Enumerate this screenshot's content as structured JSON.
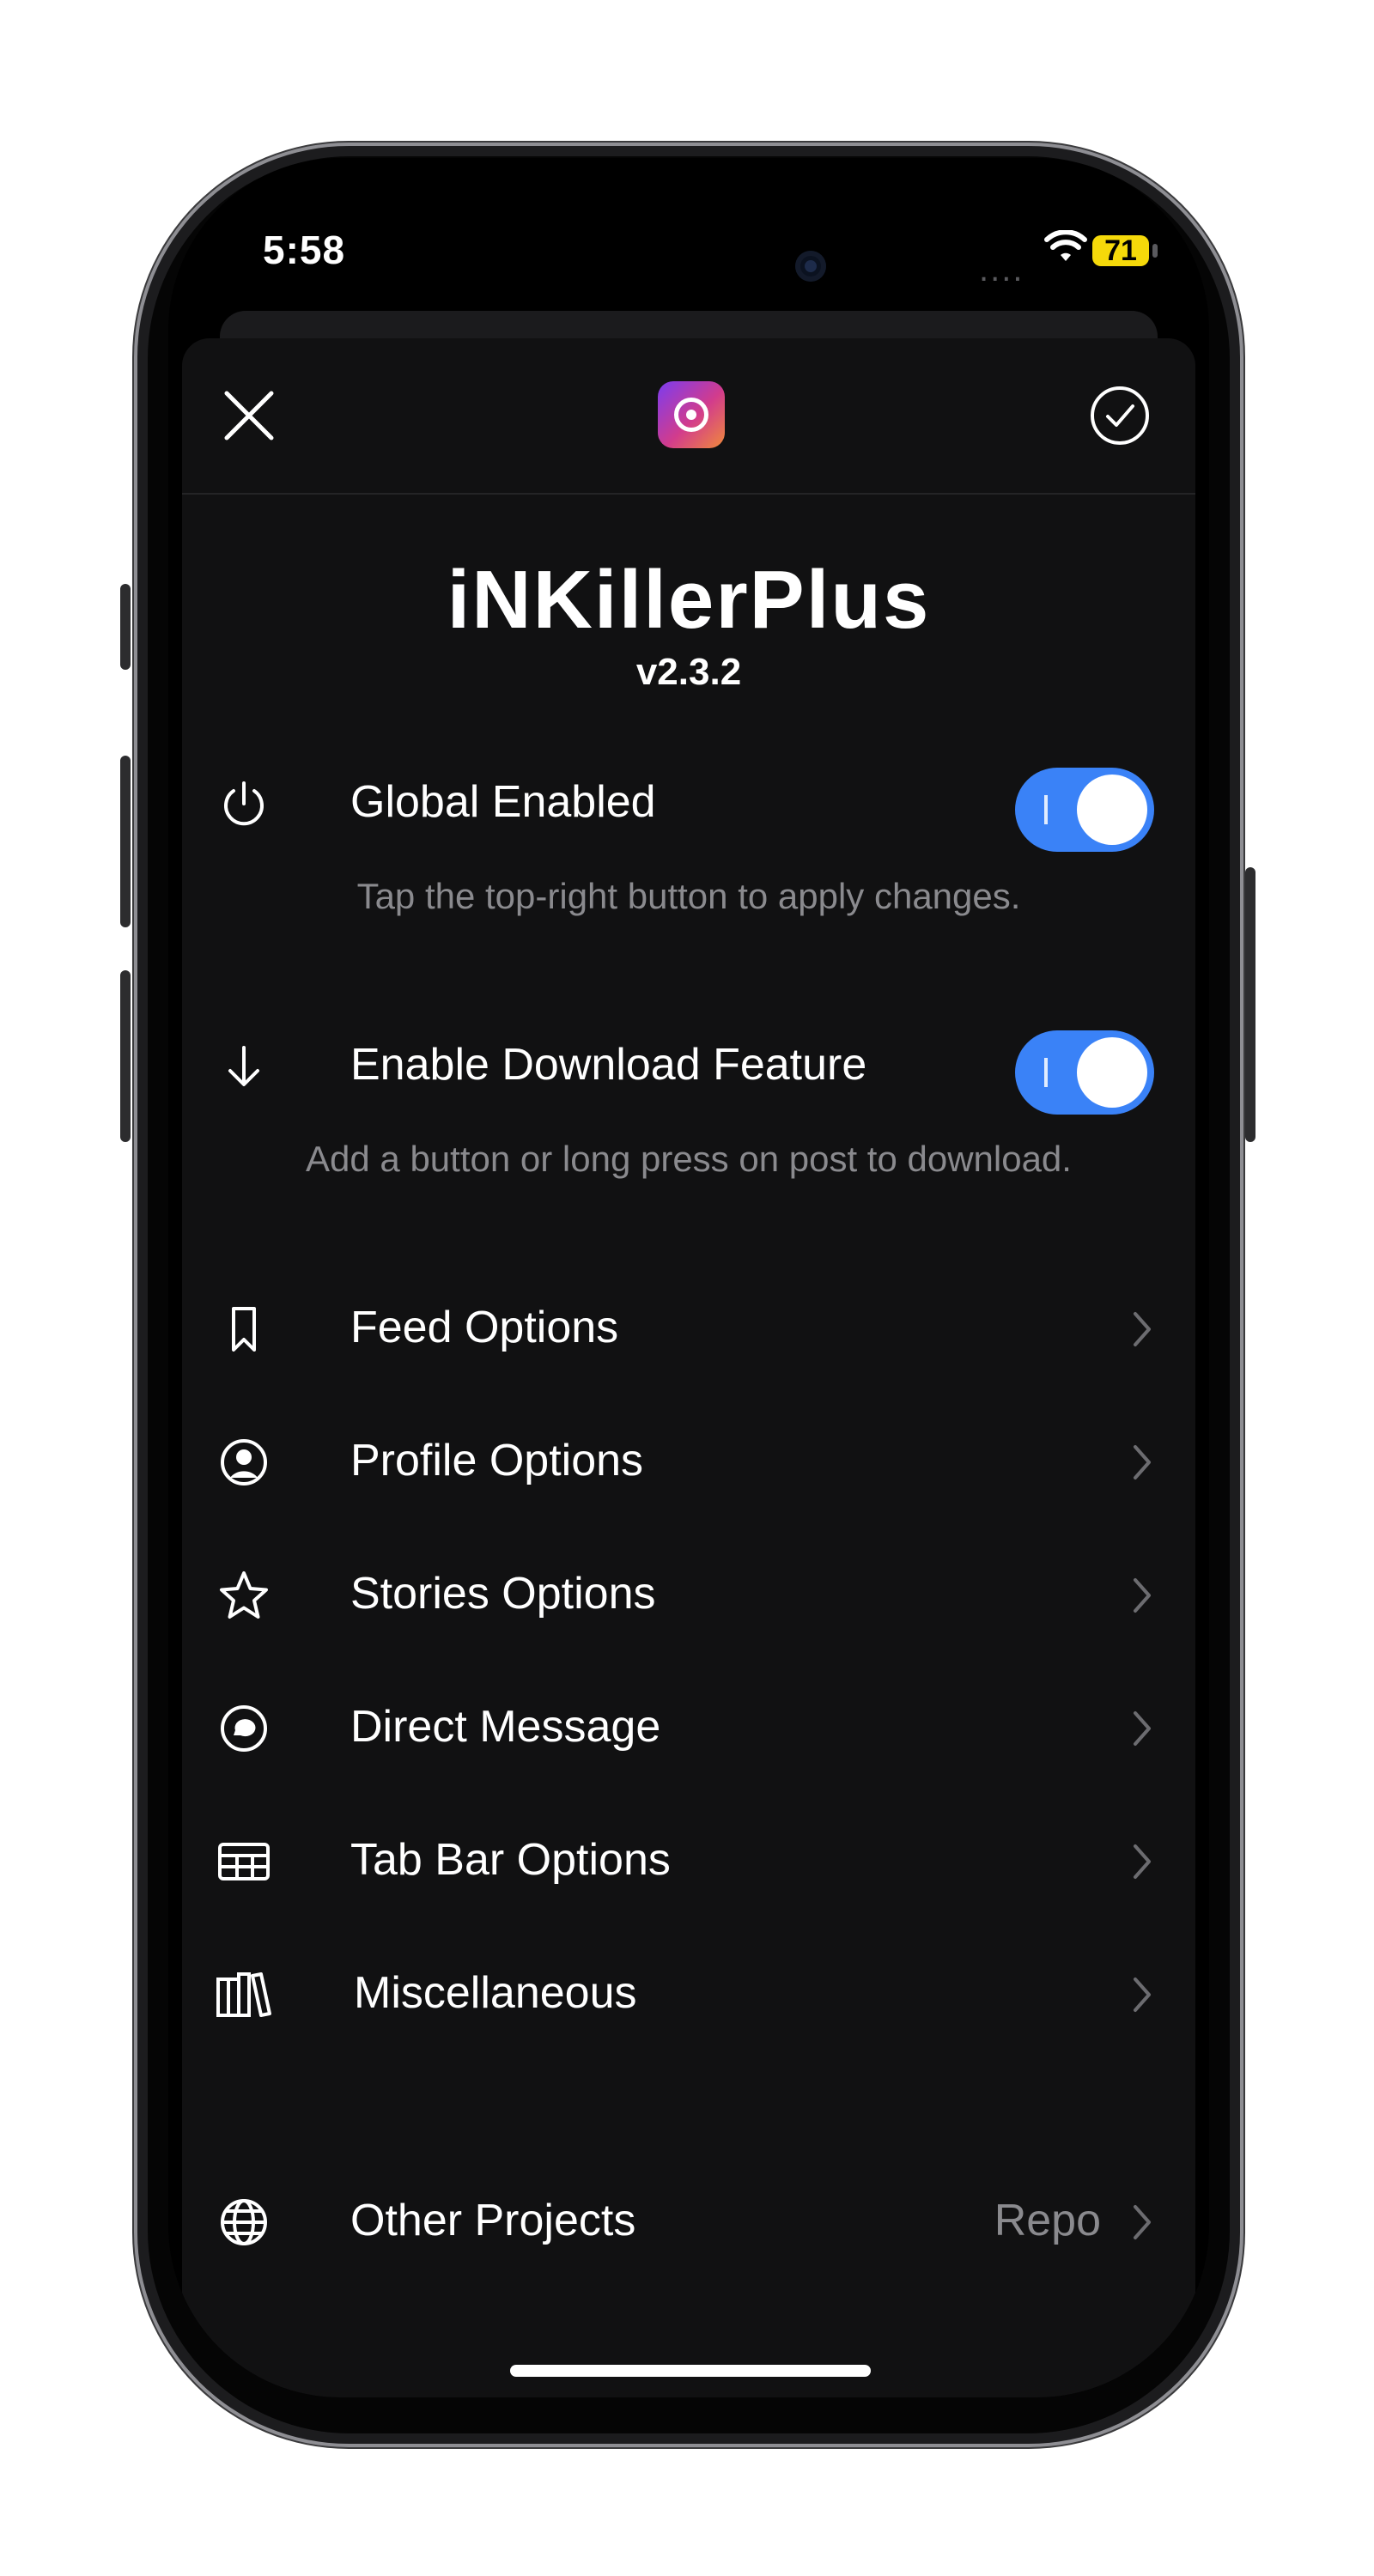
{
  "status_bar": {
    "time": "5:58",
    "signal": "....",
    "battery": "71"
  },
  "header": {
    "close_icon": "close-icon",
    "app_icon": "app-icon",
    "confirm_icon": "check-circle-icon"
  },
  "app": {
    "title": "iNKillerPlus",
    "version": "v2.3.2"
  },
  "toggles": [
    {
      "label": "Global Enabled",
      "icon": "power-icon",
      "enabled": true,
      "hint": "Tap the top-right button to apply changes."
    },
    {
      "label": "Enable Download Feature",
      "icon": "download-arrow-icon",
      "enabled": true,
      "hint": "Add a button or long press on post to download."
    }
  ],
  "menu": [
    {
      "label": "Feed Options",
      "icon": "bookmark-icon"
    },
    {
      "label": "Profile Options",
      "icon": "profile-icon"
    },
    {
      "label": "Stories Options",
      "icon": "star-icon"
    },
    {
      "label": "Direct Message",
      "icon": "message-icon"
    },
    {
      "label": "Tab Bar Options",
      "icon": "table-icon"
    },
    {
      "label": "Miscellaneous",
      "icon": "books-icon"
    }
  ],
  "other": {
    "label": "Other Projects",
    "value": "Repo",
    "icon": "globe-icon"
  },
  "colors": {
    "accent": "#3a82f7",
    "background": "#111112",
    "secondary_text": "#8a8a8e"
  }
}
